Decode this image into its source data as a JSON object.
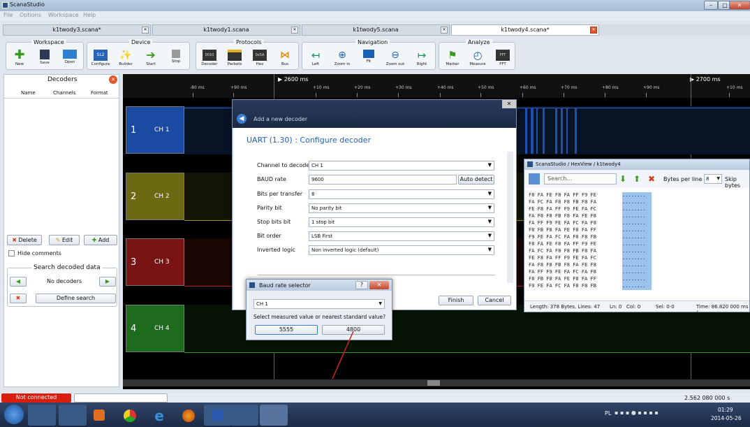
{
  "window": {
    "title": "ScanaStudio",
    "min": "–",
    "max": "□",
    "close": "✕"
  },
  "menu": [
    "File",
    "Options",
    "Workspace",
    "Help"
  ],
  "tabs": [
    {
      "label": "k1twody3.scana*"
    },
    {
      "label": "k1twody1.scana"
    },
    {
      "label": "k1twody5.scana"
    },
    {
      "label": "k1twody4.scana*"
    }
  ],
  "toolbar": {
    "groups": {
      "workspace": "Workspace",
      "device": "Device",
      "protocols": "Protocols",
      "navigation": "Navigation",
      "analyze": "Analyze"
    },
    "buttons": [
      "New",
      "Save",
      "Open",
      "Configure",
      "Builder",
      "Start",
      "Stop",
      "Decoder",
      "Packets",
      "Hex",
      "Bus",
      "Left",
      "Zoom in",
      "Fit",
      "Zoom out",
      "Right",
      "Marker",
      "Measure",
      "FFT"
    ],
    "icon_texts": {
      "sl2": "SL2",
      "decoder": "0010",
      "hex": "0x5A",
      "fft": "FFT"
    }
  },
  "decoders": {
    "title": "Decoders",
    "columns": [
      "Name",
      "Channels",
      "Format"
    ],
    "delete": "Delete",
    "edit": "Edit",
    "add": "Add",
    "hide_comments": "Hide comments",
    "search_title": "Search decoded data",
    "no_decoders": "No decoders",
    "define_search": "Define search"
  },
  "timeline": {
    "markers": [
      {
        "label": "2600 ms"
      },
      {
        "label": "2700 ms"
      }
    ],
    "ticks": [
      "-80 ms",
      "+90 ms",
      "+10 ms",
      "+20 ms",
      "+30 ms",
      "+40 ms",
      "+50 ms",
      "+60 ms",
      "+70 ms",
      "+80 ms",
      "+90 ms",
      "+10 ms"
    ]
  },
  "channels": [
    {
      "num": "1",
      "name": "CH 1",
      "color": "#1b4aa2"
    },
    {
      "num": "2",
      "name": "CH 2",
      "color": "#6b6a12"
    },
    {
      "num": "3",
      "name": "CH 3",
      "color": "#7a1414"
    },
    {
      "num": "4",
      "name": "CH 4",
      "color": "#1d6b1d"
    }
  ],
  "add_decoder": {
    "title": "Add a new decoder",
    "heading": "UART (1.30) : Configure decoder",
    "finish": "Finish",
    "cancel": "Cancel",
    "fields": [
      {
        "label": "Channel to decode",
        "value": "CH 1"
      },
      {
        "label": "BAUD rate",
        "value": "9600"
      },
      {
        "label": "Bits per transfer",
        "value": "8"
      },
      {
        "label": "Parity bit",
        "value": "No parity bit"
      },
      {
        "label": "Stop bits bit",
        "value": "1 stop bit"
      },
      {
        "label": "Bit order",
        "value": "LSB First"
      },
      {
        "label": "Inverted logic",
        "value": "Non inverted logic (default)"
      }
    ],
    "auto_detect": "Auto detect"
  },
  "baud_selector": {
    "title": "Baud rate selector",
    "help": "?",
    "channel": "CH 1",
    "prompt": "Select measured value or nearest standard value?",
    "measured": "5555",
    "standard": "4800"
  },
  "hexview": {
    "title": "ScanaStudio / HexView / k1twody4",
    "search_placeholder": "Search...",
    "bytes_per_line_label": "Bytes per line :",
    "bytes_per_line": "8",
    "skip": "Skip bytes",
    "rows": [
      "F8 FA FE F8 FA FF F9 FE",
      "FA FC FA F8 F8 FB F8 FA",
      "FE F8 FA FF F9 FE FA FC",
      "FA F8 F8 FB F8 FA FE F8",
      "FA FF F9 FE FA FC FA F8",
      "F8 FB F8 FA FE F8 FA FF",
      "F9 FE FA FC FA F8 F8 FB",
      "F8 FA FE F8 FA FF F9 FE",
      "FA FC FA F8 F8 FB F8 FA",
      "FE F8 FA FF F9 FE FA FC",
      "FA F8 F8 FB F8 FA FE F8",
      "FA FF F9 FE FA FC FA F8",
      "F8 FB F8 FA FE F8 FA FF",
      "F9 FE FA FC FA F8 F8 FB"
    ],
    "ascii": "........",
    "status": {
      "length": "Length: 378  Bytes, Lines: 47",
      "ln": "Ln: 0",
      "col": "Col: 0",
      "sel": "Sel: 0-0",
      "time": "Time: 86.820 000 ms /"
    }
  },
  "statusbar": {
    "connection": "Not connected",
    "time": "2.562 080 000 s"
  },
  "tray": {
    "lang": "PL",
    "clock": "01:29",
    "date": "2014-05-26"
  }
}
